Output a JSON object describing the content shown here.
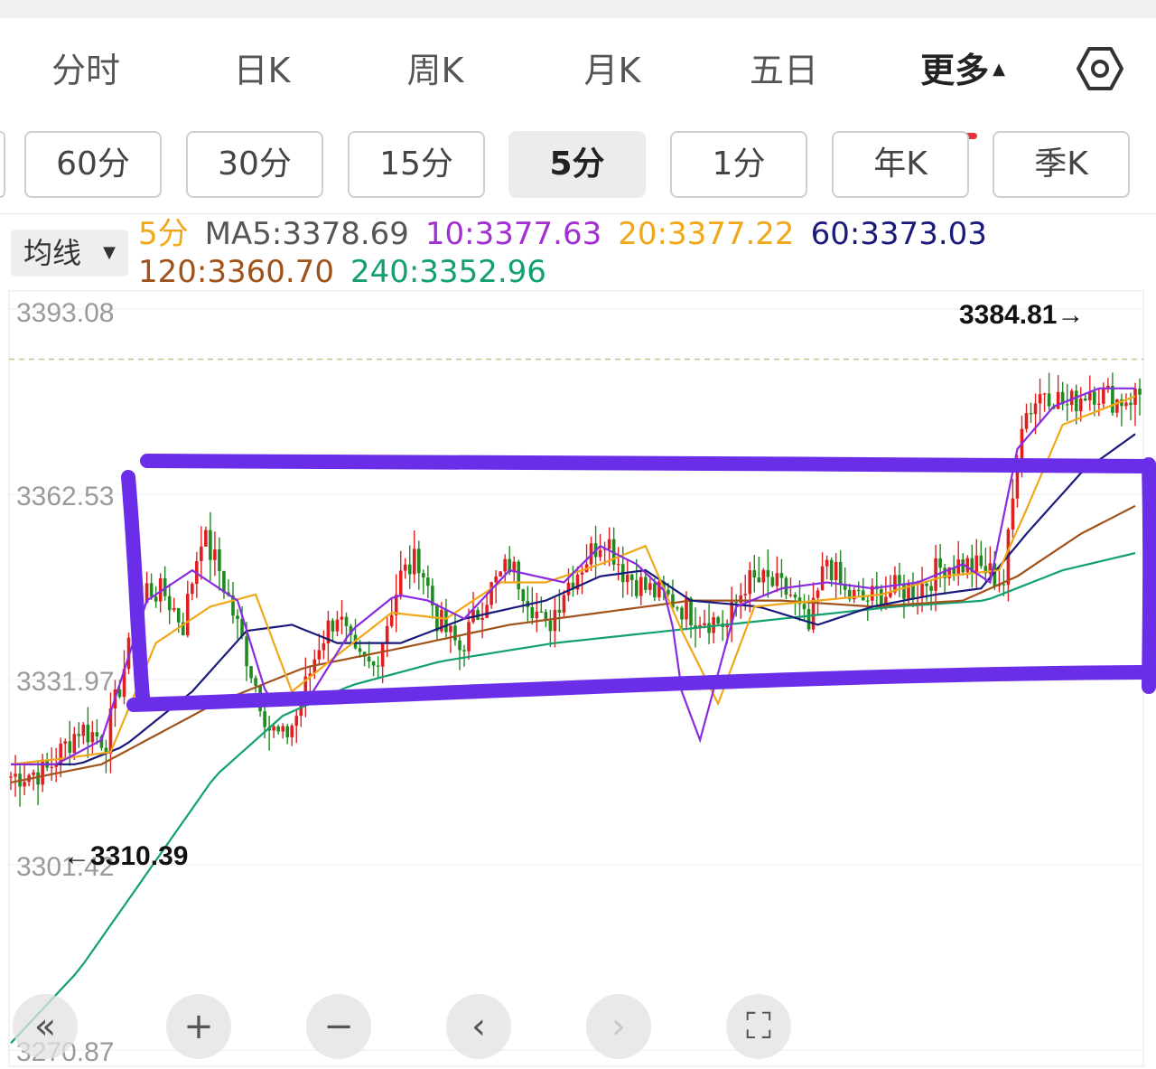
{
  "tabs": [
    {
      "label": "分时"
    },
    {
      "label": "日K"
    },
    {
      "label": "周K"
    },
    {
      "label": "月K"
    },
    {
      "label": "五日"
    },
    {
      "label": "更多",
      "active": true
    }
  ],
  "settings_icon": "hexagon-gear-icon",
  "periods": [
    {
      "label": "60分"
    },
    {
      "label": "30分"
    },
    {
      "label": "15分"
    },
    {
      "label": "5分",
      "active": true
    },
    {
      "label": "1分"
    },
    {
      "label": "年K"
    },
    {
      "label": "季K"
    }
  ],
  "ma_selector": {
    "label": "均线"
  },
  "legend": {
    "period": "5分",
    "ma5": "MA5:3378.69",
    "ma10": "10:3377.63",
    "ma20": "20:3377.22",
    "ma60": "60:3373.03",
    "ma120": "120:3360.70",
    "ma240": "240:3352.96"
  },
  "colors": {
    "up": "#e02020",
    "down": "#1f8a1f",
    "ma5": "#8a2be2",
    "ma10": "#a22fd0",
    "ma20": "#f0a818",
    "ma60": "#1a1a7a",
    "ma120": "#a0521a",
    "ma240": "#12a070",
    "annotation": "#6b2ee8"
  },
  "chart_data": {
    "type": "candlestick",
    "y_ticks": [
      "3393.08",
      "3362.53",
      "3331.97",
      "3301.42",
      "3270.87"
    ],
    "ylim": [
      3270.87,
      3393.08
    ],
    "high_label": "3384.81→",
    "low_label": "←3310.39",
    "last_price_line": 3384.81,
    "ma_series": [
      {
        "name": "MA5",
        "last": 3378.69
      },
      {
        "name": "10",
        "last": 3377.63
      },
      {
        "name": "20",
        "last": 3377.22
      },
      {
        "name": "60",
        "last": 3373.03
      },
      {
        "name": "120",
        "last": 3360.7
      },
      {
        "name": "240",
        "last": 3352.96
      }
    ],
    "close_path": [
      [
        0,
        3316
      ],
      [
        8,
        3317
      ],
      [
        15,
        3324
      ],
      [
        21,
        3322
      ],
      [
        25,
        3334
      ],
      [
        30,
        3347
      ],
      [
        34,
        3346
      ],
      [
        38,
        3341
      ],
      [
        42,
        3356
      ],
      [
        46,
        3350
      ],
      [
        52,
        3336
      ],
      [
        57,
        3324
      ],
      [
        60,
        3322
      ],
      [
        63,
        3326
      ],
      [
        68,
        3338
      ],
      [
        72,
        3343
      ],
      [
        76,
        3335
      ],
      [
        80,
        3334
      ],
      [
        86,
        3349
      ],
      [
        90,
        3352
      ],
      [
        94,
        3342
      ],
      [
        99,
        3337
      ],
      [
        105,
        3346
      ],
      [
        110,
        3351
      ],
      [
        114,
        3346
      ],
      [
        118,
        3340
      ],
      [
        122,
        3347
      ],
      [
        127,
        3352
      ],
      [
        131,
        3356
      ],
      [
        135,
        3350
      ],
      [
        140,
        3347
      ],
      [
        146,
        3345
      ],
      [
        150,
        3343
      ],
      [
        154,
        3342
      ],
      [
        158,
        3341
      ],
      [
        162,
        3348
      ],
      [
        167,
        3348
      ],
      [
        172,
        3346
      ],
      [
        176,
        3340
      ],
      [
        180,
        3352
      ],
      [
        184,
        3346
      ],
      [
        188,
        3345
      ],
      [
        192,
        3346
      ],
      [
        196,
        3347
      ],
      [
        200,
        3347
      ],
      [
        206,
        3351
      ],
      [
        210,
        3351
      ],
      [
        215,
        3350
      ],
      [
        219,
        3348
      ],
      [
        223,
        3375
      ],
      [
        228,
        3380
      ],
      [
        233,
        3377
      ],
      [
        238,
        3380
      ],
      [
        244,
        3378
      ],
      [
        249,
        3379
      ]
    ],
    "ma_paths": {
      "ma5": [
        [
          0,
          3318
        ],
        [
          10,
          3318
        ],
        [
          20,
          3322
        ],
        [
          30,
          3345
        ],
        [
          40,
          3350
        ],
        [
          50,
          3345
        ],
        [
          57,
          3328
        ],
        [
          65,
          3328
        ],
        [
          75,
          3340
        ],
        [
          85,
          3346
        ],
        [
          92,
          3345
        ],
        [
          100,
          3342
        ],
        [
          110,
          3350
        ],
        [
          122,
          3348
        ],
        [
          130,
          3354
        ],
        [
          138,
          3351
        ],
        [
          145,
          3346
        ],
        [
          148,
          3330
        ],
        [
          152,
          3322
        ],
        [
          160,
          3344
        ],
        [
          170,
          3347
        ],
        [
          180,
          3348
        ],
        [
          190,
          3347
        ],
        [
          200,
          3348
        ],
        [
          210,
          3351
        ],
        [
          216,
          3348
        ],
        [
          222,
          3370
        ],
        [
          230,
          3377
        ],
        [
          240,
          3380
        ],
        [
          249,
          3380
        ]
      ],
      "ma20": [
        [
          0,
          3318
        ],
        [
          12,
          3319
        ],
        [
          22,
          3320
        ],
        [
          32,
          3338
        ],
        [
          44,
          3344
        ],
        [
          54,
          3346
        ],
        [
          62,
          3330
        ],
        [
          72,
          3336
        ],
        [
          84,
          3343
        ],
        [
          96,
          3342
        ],
        [
          108,
          3348
        ],
        [
          118,
          3348
        ],
        [
          130,
          3351
        ],
        [
          140,
          3354
        ],
        [
          148,
          3340
        ],
        [
          156,
          3328
        ],
        [
          164,
          3344
        ],
        [
          178,
          3345
        ],
        [
          192,
          3346
        ],
        [
          206,
          3349
        ],
        [
          218,
          3350
        ],
        [
          224,
          3360
        ],
        [
          232,
          3374
        ],
        [
          249,
          3379
        ]
      ],
      "ma60": [
        [
          0,
          3318
        ],
        [
          15,
          3318
        ],
        [
          25,
          3321
        ],
        [
          40,
          3330
        ],
        [
          52,
          3340
        ],
        [
          62,
          3341
        ],
        [
          72,
          3338
        ],
        [
          86,
          3338
        ],
        [
          100,
          3342
        ],
        [
          118,
          3345
        ],
        [
          130,
          3349
        ],
        [
          140,
          3350
        ],
        [
          150,
          3345
        ],
        [
          165,
          3344
        ],
        [
          178,
          3341
        ],
        [
          190,
          3344
        ],
        [
          204,
          3346
        ],
        [
          214,
          3347
        ],
        [
          224,
          3356
        ],
        [
          236,
          3366
        ],
        [
          249,
          3373
        ]
      ],
      "ma120": [
        [
          0,
          3315
        ],
        [
          20,
          3318
        ],
        [
          45,
          3328
        ],
        [
          65,
          3334
        ],
        [
          85,
          3337
        ],
        [
          110,
          3341
        ],
        [
          130,
          3343
        ],
        [
          150,
          3345
        ],
        [
          170,
          3345
        ],
        [
          190,
          3344
        ],
        [
          210,
          3345
        ],
        [
          222,
          3349
        ],
        [
          236,
          3356
        ],
        [
          249,
          3361
        ]
      ],
      "ma240": [
        [
          0,
          3272
        ],
        [
          15,
          3284
        ],
        [
          30,
          3300
        ],
        [
          45,
          3316
        ],
        [
          60,
          3326
        ],
        [
          75,
          3331
        ],
        [
          95,
          3335
        ],
        [
          120,
          3338
        ],
        [
          145,
          3340
        ],
        [
          170,
          3342
        ],
        [
          195,
          3344
        ],
        [
          215,
          3345
        ],
        [
          232,
          3350
        ],
        [
          249,
          3353
        ]
      ]
    }
  },
  "annotation": {
    "shape": "rectangle",
    "note": "hand-drawn purple box around consolidation range"
  },
  "nav": [
    {
      "icon": "double-chevron-left-icon",
      "glyph": "«"
    },
    {
      "icon": "zoom-in-icon",
      "glyph": "+"
    },
    {
      "icon": "zoom-out-icon",
      "glyph": "−"
    },
    {
      "icon": "chevron-left-icon",
      "glyph": "‹"
    },
    {
      "icon": "chevron-right-icon",
      "glyph": "›",
      "disabled": true
    },
    {
      "icon": "fullscreen-icon",
      "glyph": "⛶"
    }
  ]
}
